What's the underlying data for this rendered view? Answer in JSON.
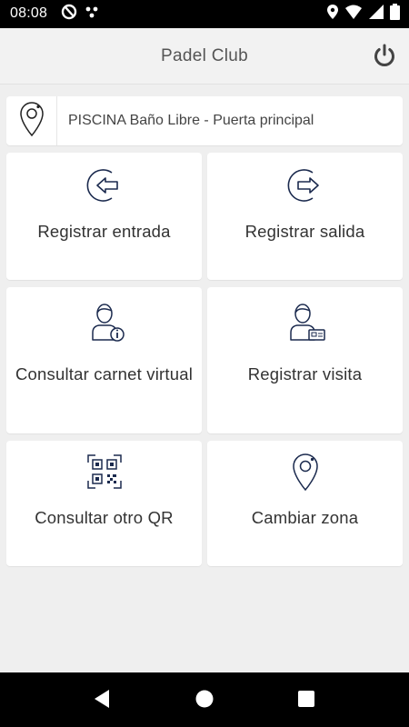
{
  "status_bar": {
    "time": "08:08",
    "left_icons": [
      "data-saver-icon",
      "dots-icon"
    ],
    "right_icons": [
      "location-icon",
      "wifi-icon",
      "signal-icon",
      "battery-icon"
    ]
  },
  "app_bar": {
    "title": "Padel Club",
    "power_icon": "power-icon"
  },
  "zone": {
    "icon": "location-pin-icon",
    "label": "PISCINA Baño Libre - Puerta principal"
  },
  "tiles": [
    {
      "label": "Registrar entrada",
      "icon": "enter-icon"
    },
    {
      "label": "Registrar salida",
      "icon": "exit-icon"
    },
    {
      "label": "Consultar carnet virtual",
      "icon": "user-info-icon"
    },
    {
      "label": "Registrar visita",
      "icon": "user-card-icon"
    },
    {
      "label": "Consultar otro QR",
      "icon": "qr-code-icon"
    },
    {
      "label": "Cambiar zona",
      "icon": "location-pin-icon"
    }
  ],
  "nav_bar": {
    "icons": [
      "back-icon",
      "home-icon",
      "recents-icon"
    ]
  },
  "colors": {
    "accent": "#1b2a4e",
    "background": "#efefef",
    "tile": "#ffffff"
  }
}
